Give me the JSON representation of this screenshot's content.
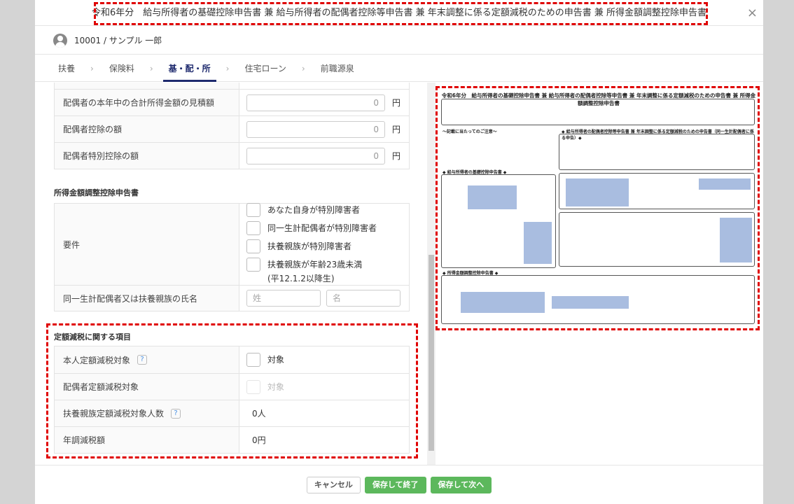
{
  "title": "令和6年分　給与所得者の基礎控除申告書 兼 給与所得者の配偶者控除等申告書 兼 年末調整に係る定額減税のための申告書 兼 所得金額調整控除申告書",
  "close": "×",
  "user": "10001 / サンプル 一郎",
  "tabs": [
    "扶養",
    "保険料",
    "基・配・所",
    "住宅ローン",
    "前職源泉"
  ],
  "tab_sep": "›",
  "spouse_rows": [
    {
      "label": "配偶者の本年中の合計所得金額の見積額",
      "value": "0",
      "unit": "円"
    },
    {
      "label": "配偶者控除の額",
      "value": "0",
      "unit": "円"
    },
    {
      "label": "配偶者特別控除の額",
      "value": "0",
      "unit": "円"
    }
  ],
  "adjust": {
    "heading": "所得金額調整控除申告書",
    "req_label": "要件",
    "options": [
      "あなた自身が特別障害者",
      "同一生計配偶者が特別障害者",
      "扶養親族が特別障害者",
      "扶養親族が年齢23歳未満",
      "(平12.1.2以降生)"
    ],
    "name_label": "同一生計配偶者又は扶養親族の氏名",
    "last_placeholder": "姓",
    "first_placeholder": "名"
  },
  "flat": {
    "heading": "定額減税に関する項目",
    "self_label": "本人定額減税対象",
    "self_check": "対象",
    "spouse_label": "配偶者定額減税対象",
    "spouse_check": "対象",
    "dep_label": "扶養親族定額減税対象人数",
    "dep_value": "0人",
    "amount_label": "年調減税額",
    "amount_value": "0円",
    "help": "?"
  },
  "preview": {
    "title": "令和6年分　給与所得者の基礎控除申告書 兼 給与所得者の配偶者控除等申告書 兼 年末調整に係る定額減税のための申告書 兼 所得金額調整控除申告書",
    "notes": "～記載に当たってのご注意～",
    "basic": "◆ 給与所得者の基礎控除申告書 ◆",
    "spouse": "◆ 給与所得者の配偶者控除等申告書 兼 年末調整に係る定額減税のための申告書（同一生計配偶者に係る申告）◆",
    "adjust": "◆ 所得金額調整控除申告書 ◆"
  },
  "footer": {
    "cancel": "キャンセル",
    "save_exit": "保存して終了",
    "save_next": "保存して次へ"
  }
}
